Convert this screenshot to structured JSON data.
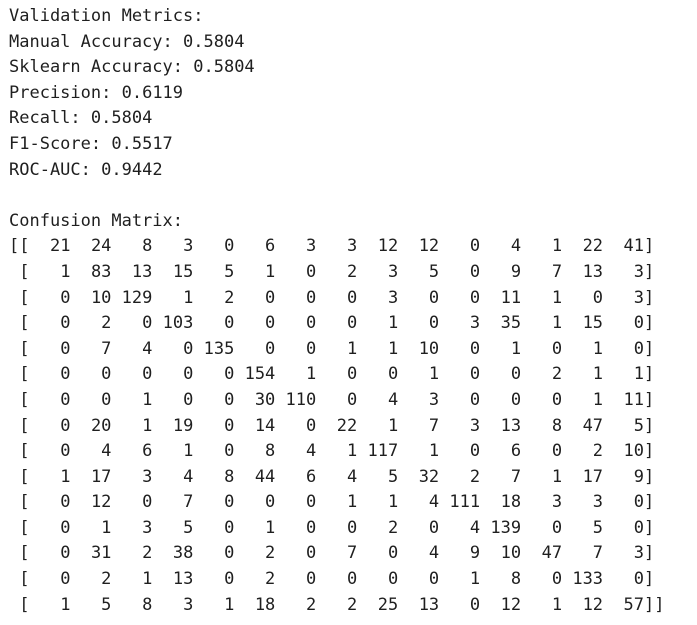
{
  "metrics_header": "Validation Metrics:",
  "metrics": [
    {
      "label": "Manual Accuracy:",
      "value": "0.5804"
    },
    {
      "label": "Sklearn Accuracy:",
      "value": "0.5804"
    },
    {
      "label": "Precision:",
      "value": "0.6119"
    },
    {
      "label": "Recall:",
      "value": "0.5804"
    },
    {
      "label": "F1-Score:",
      "value": "0.5517"
    },
    {
      "label": "ROC-AUC:",
      "value": "0.9442"
    }
  ],
  "confusion_header": "Confusion Matrix:",
  "confusion_matrix": [
    [
      21,
      24,
      8,
      3,
      0,
      6,
      3,
      3,
      12,
      12,
      0,
      4,
      1,
      22,
      41
    ],
    [
      1,
      83,
      13,
      15,
      5,
      1,
      0,
      2,
      3,
      5,
      0,
      9,
      7,
      13,
      3
    ],
    [
      0,
      10,
      129,
      1,
      2,
      0,
      0,
      0,
      3,
      0,
      0,
      11,
      1,
      0,
      3
    ],
    [
      0,
      2,
      0,
      103,
      0,
      0,
      0,
      0,
      1,
      0,
      3,
      35,
      1,
      15,
      0
    ],
    [
      0,
      7,
      4,
      0,
      135,
      0,
      0,
      1,
      1,
      10,
      0,
      1,
      0,
      1,
      0
    ],
    [
      0,
      0,
      0,
      0,
      0,
      154,
      1,
      0,
      0,
      1,
      0,
      0,
      2,
      1,
      1
    ],
    [
      0,
      0,
      1,
      0,
      0,
      30,
      110,
      0,
      4,
      3,
      0,
      0,
      0,
      1,
      11
    ],
    [
      0,
      20,
      1,
      19,
      0,
      14,
      0,
      22,
      1,
      7,
      3,
      13,
      8,
      47,
      5
    ],
    [
      0,
      4,
      6,
      1,
      0,
      8,
      4,
      1,
      117,
      1,
      0,
      6,
      0,
      2,
      10
    ],
    [
      1,
      17,
      3,
      4,
      8,
      44,
      6,
      4,
      5,
      32,
      2,
      7,
      1,
      17,
      9
    ],
    [
      0,
      12,
      0,
      7,
      0,
      0,
      0,
      1,
      1,
      4,
      111,
      18,
      3,
      3,
      0
    ],
    [
      0,
      1,
      3,
      5,
      0,
      1,
      0,
      0,
      2,
      0,
      4,
      139,
      0,
      5,
      0
    ],
    [
      0,
      31,
      2,
      38,
      0,
      2,
      0,
      7,
      0,
      4,
      9,
      10,
      47,
      7,
      3
    ],
    [
      0,
      2,
      1,
      13,
      0,
      2,
      0,
      0,
      0,
      0,
      1,
      8,
      0,
      133,
      0
    ],
    [
      1,
      5,
      8,
      3,
      1,
      18,
      2,
      2,
      25,
      13,
      0,
      12,
      1,
      12,
      57
    ]
  ]
}
